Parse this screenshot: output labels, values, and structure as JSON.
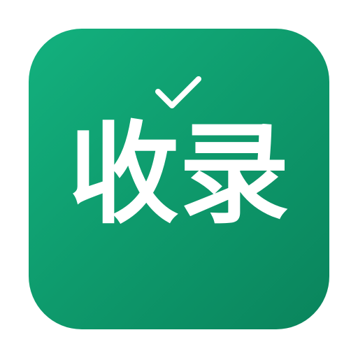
{
  "icon": {
    "label": "收录",
    "background_colors": [
      "#13b17e",
      "#0a845c"
    ],
    "foreground_color": "#ffffff",
    "badge_icon": "checkmark-icon"
  }
}
